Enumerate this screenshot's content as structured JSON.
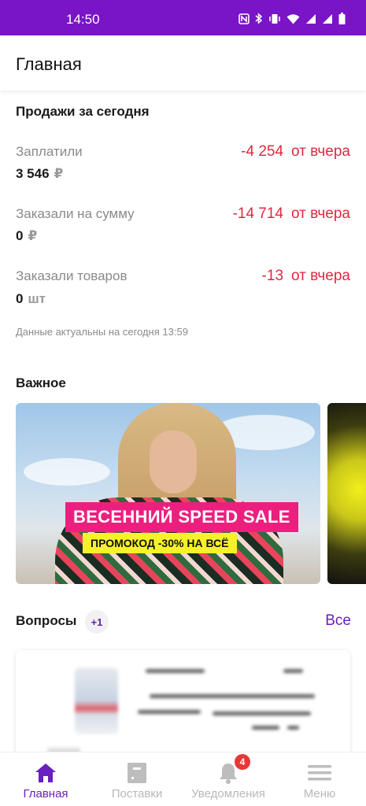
{
  "status_bar": {
    "time": "14:50",
    "icons": [
      "nfc-icon",
      "bluetooth-icon",
      "vibrate-icon",
      "wifi-icon",
      "signal-icon",
      "signal-icon",
      "battery-icon"
    ]
  },
  "header": {
    "title": "Главная"
  },
  "sales": {
    "title": "Продажи за сегодня",
    "metrics": [
      {
        "label": "Заплатили",
        "value": "3 546",
        "unit": "₽",
        "diff": "-4 254",
        "diff_ref": "от вчера"
      },
      {
        "label": "Заказали на сумму",
        "value": "0",
        "unit": "₽",
        "diff": "-14 714",
        "diff_ref": "от вчера"
      },
      {
        "label": "Заказали товаров",
        "value": "0",
        "unit": "шт",
        "diff": "-13",
        "diff_ref": "от вчера"
      }
    ],
    "note": "Данные актуальны на сегодня 13:59"
  },
  "important": {
    "title": "Важное",
    "banner": {
      "headline": "ВЕСЕННИЙ SPEED SALE",
      "promo": "ПРОМОКОД -30% НА ВСЁ"
    }
  },
  "questions": {
    "title": "Вопросы",
    "badge": "+1",
    "all_link": "Все"
  },
  "bottom_nav": {
    "items": [
      {
        "label": "Главная",
        "icon": "home-icon",
        "active": true
      },
      {
        "label": "Поставки",
        "icon": "box-icon",
        "active": false
      },
      {
        "label": "Уведомления",
        "icon": "bell-icon",
        "active": false,
        "badge": "4"
      },
      {
        "label": "Меню",
        "icon": "menu-icon",
        "active": false
      }
    ]
  },
  "colors": {
    "accent": "#7a14c7",
    "negative": "#e0283e",
    "badge": "#e53935",
    "promo_pink": "#ec1f7f",
    "promo_yellow": "#f6f22a"
  }
}
